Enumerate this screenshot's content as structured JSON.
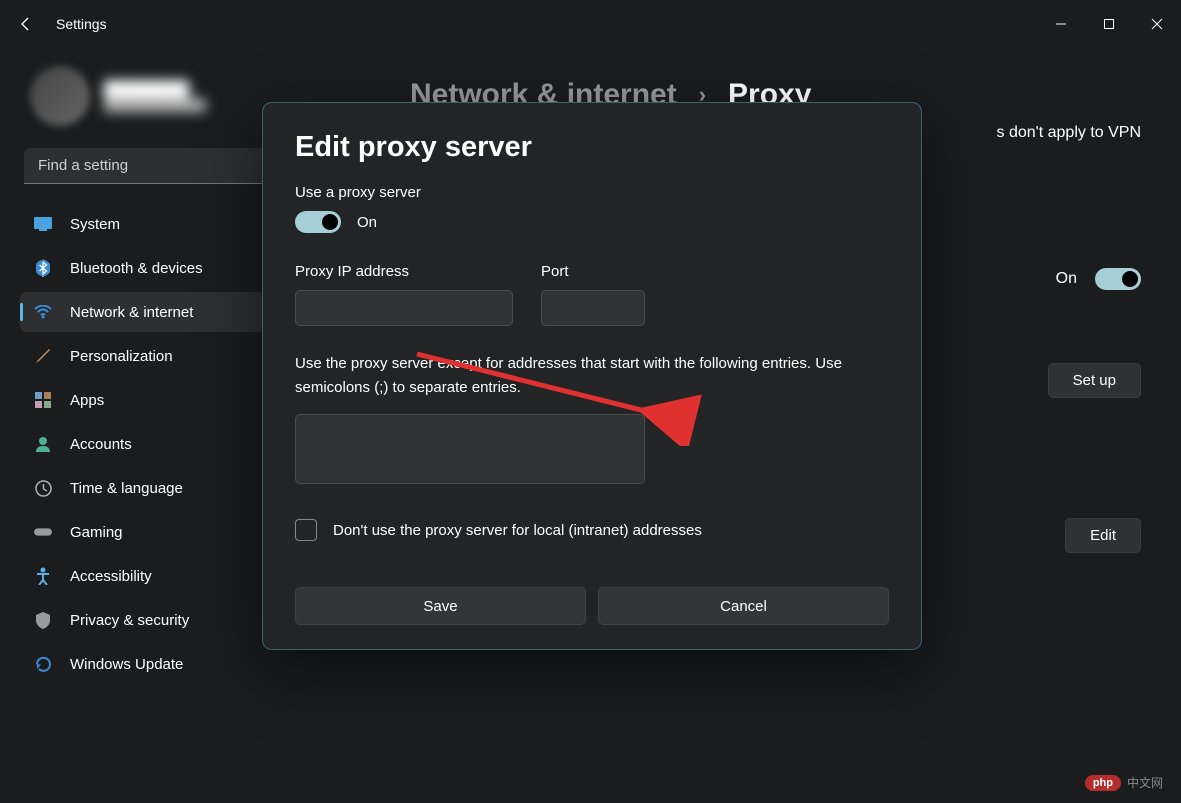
{
  "app": {
    "title": "Settings"
  },
  "sidebar": {
    "search_placeholder": "Find a setting",
    "items": [
      {
        "id": "system",
        "label": "System",
        "icon_color": "#4aa3e0"
      },
      {
        "id": "bluetooth",
        "label": "Bluetooth & devices",
        "icon_color": "#3b8bd6"
      },
      {
        "id": "network",
        "label": "Network & internet",
        "icon_color": "#3b8bd6"
      },
      {
        "id": "personalization",
        "label": "Personalization",
        "icon_color": "#c09060"
      },
      {
        "id": "apps",
        "label": "Apps",
        "icon_color": "#6f9dc8"
      },
      {
        "id": "accounts",
        "label": "Accounts",
        "icon_color": "#4db293"
      },
      {
        "id": "time",
        "label": "Time & language",
        "icon_color": "#b0b0b0"
      },
      {
        "id": "gaming",
        "label": "Gaming",
        "icon_color": "#9a9a9a"
      },
      {
        "id": "accessibility",
        "label": "Accessibility",
        "icon_color": "#5ab0e0"
      },
      {
        "id": "privacy",
        "label": "Privacy & security",
        "icon_color": "#9a9a9a"
      },
      {
        "id": "update",
        "label": "Windows Update",
        "icon_color": "#3b8bd6"
      }
    ]
  },
  "breadcrumb": {
    "parent": "Network & internet",
    "sep": "›",
    "current": "Proxy"
  },
  "content": {
    "vpn_hint_fragment": "s don't apply to VPN",
    "on_row_label": "On",
    "setup_button": "Set up",
    "edit_button": "Edit"
  },
  "dialog": {
    "title": "Edit proxy server",
    "use_proxy_label": "Use a proxy server",
    "toggle_state": "On",
    "ip_label": "Proxy IP address",
    "ip_value": "",
    "port_label": "Port",
    "port_value": "",
    "exceptions_help": "Use the proxy server except for addresses that start with the following entries. Use semicolons (;) to separate entries.",
    "exceptions_value": "",
    "local_checkbox_label": "Don't use the proxy server for local (intranet) addresses",
    "save_label": "Save",
    "cancel_label": "Cancel"
  },
  "watermark": {
    "badge": "php",
    "text": "中文网"
  }
}
